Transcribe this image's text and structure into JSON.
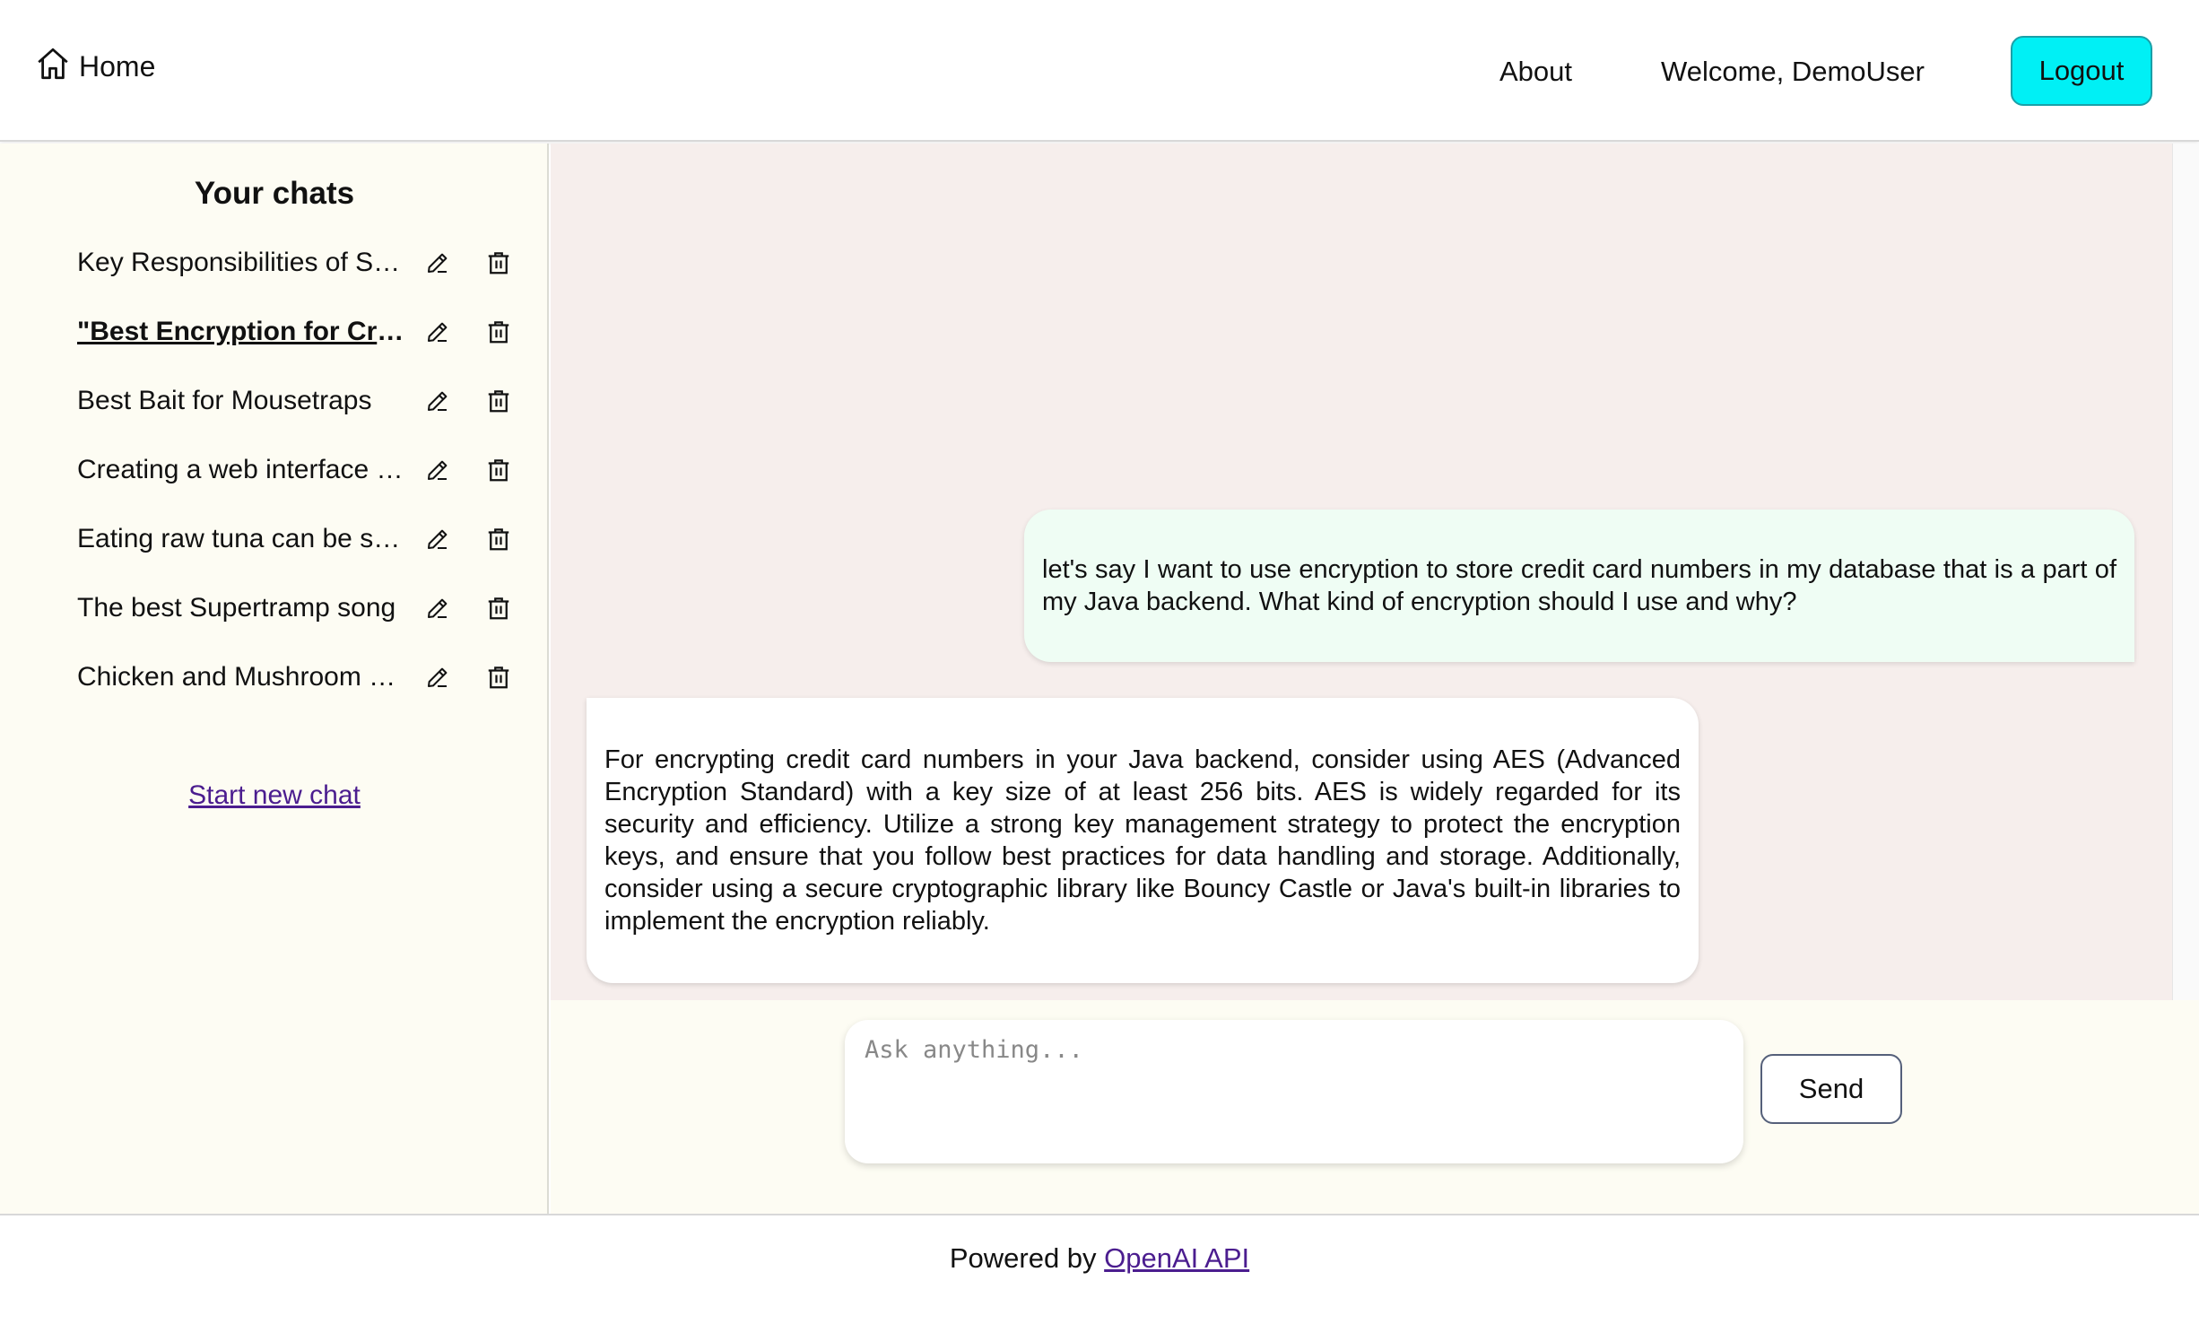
{
  "header": {
    "home_label": "Home",
    "about_label": "About",
    "welcome_text": "Welcome, DemoUser",
    "logout_label": "Logout"
  },
  "sidebar": {
    "title": "Your chats",
    "chats": [
      {
        "title": "Key Responsibilities of Software Engineers",
        "active": false
      },
      {
        "title": "\"Best Encryption for Credit Card Numbers\"",
        "active": true
      },
      {
        "title": "Best Bait for Mousetraps",
        "active": false
      },
      {
        "title": "Creating a web interface for chat",
        "active": false
      },
      {
        "title": "Eating raw tuna can be safe",
        "active": false
      },
      {
        "title": "The best Supertramp song",
        "active": false
      },
      {
        "title": "Chicken and Mushroom Recipe",
        "active": false
      }
    ],
    "new_chat_label": "Start new chat"
  },
  "messages": [
    {
      "role": "user",
      "text": "let's say I want to use encryption to store credit card numbers in my database that is a part of my Java backend. What kind of encryption should I use and why?"
    },
    {
      "role": "assistant",
      "text": "For encrypting credit card numbers in your Java backend, consider using AES (Advanced Encryption Standard) with a key size of at least 256 bits. AES is widely regarded for its security and efficiency. Utilize a strong key management strategy to protect the encryption keys, and ensure that you follow best practices for data handling and storage. Additionally, consider using a secure cryptographic library like Bouncy Castle or Java's built-in libraries to implement the encryption reliably."
    }
  ],
  "composer": {
    "placeholder": "Ask anything...",
    "value": "",
    "send_label": "Send"
  },
  "footer": {
    "prefix": "Powered by",
    "link_label": "OpenAI API"
  },
  "colors": {
    "logout_bg": "#00f0f5",
    "sidebar_bg": "#fdfcf3",
    "messages_bg": "#f6eeec",
    "user_bubble": "#effdf4",
    "link": "#4b1d8f"
  }
}
